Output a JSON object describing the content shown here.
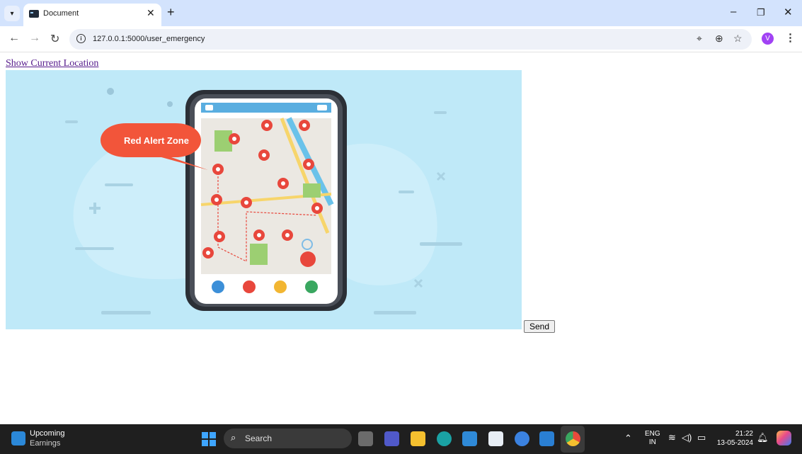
{
  "browser": {
    "tab_title": "Document",
    "tab_close": "✕",
    "new_tab": "+",
    "url": "127.0.0.1:5000/user_emergency",
    "profile_initial": "V",
    "icons": [
      "tab-search-icon",
      "document-favicon-icon",
      "back-icon",
      "forward-icon",
      "reload-icon",
      "site-info-icon",
      "location-icon",
      "zoom-icon",
      "bookmark-star-icon",
      "menu-dots-icon",
      "minimize-icon",
      "restore-icon",
      "close-icon"
    ]
  },
  "page": {
    "location_link": "Show Current Location",
    "illustration": {
      "bubble_text": "Red Alert Zone",
      "colors": {
        "background": "#bfe9f8",
        "bubble": "#f2553a",
        "pin": "#e8473c"
      }
    },
    "send_label": "Send"
  },
  "taskbar": {
    "widget_title": "Upcoming",
    "widget_subtitle": "Earnings",
    "search_label": "Search",
    "language_top": "ENG",
    "language_bottom": "IN",
    "time": "21:22",
    "date": "13-05-2024",
    "apps": [
      "file-explorer-icon",
      "teams-icon",
      "folder-icon",
      "edge-icon",
      "mylp-icon",
      "store-icon",
      "copilot-icon",
      "vscode-icon",
      "chrome-icon"
    ]
  }
}
